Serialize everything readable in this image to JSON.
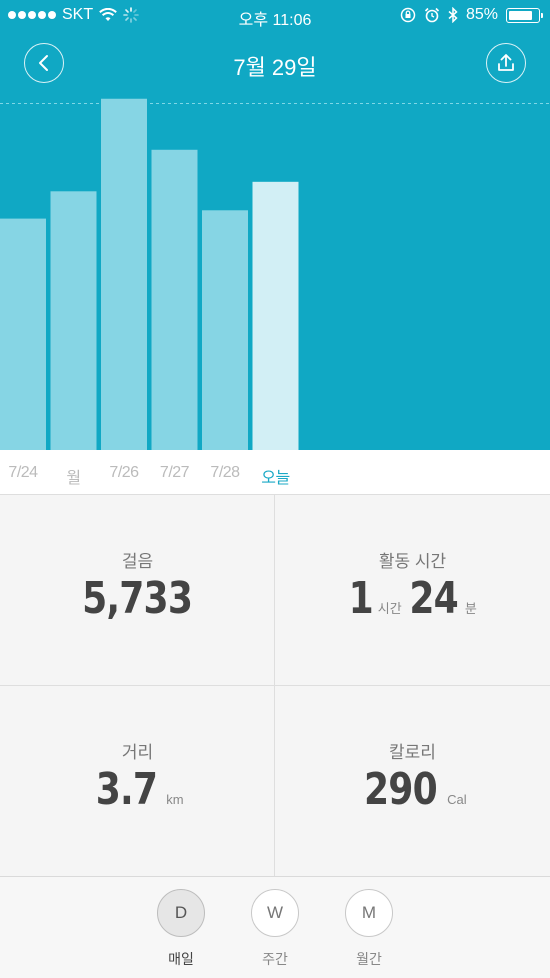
{
  "status_bar": {
    "carrier": "SKT",
    "time": "오후 11:06",
    "battery": "85%",
    "battery_level": 0.85
  },
  "header": {
    "title": "7월 29일",
    "back_icon": "chevron-left-icon",
    "share_icon": "upload-icon"
  },
  "chart_data": {
    "type": "bar",
    "categories": [
      "7/24",
      "월",
      "7/26",
      "7/27",
      "7/28",
      "오늘"
    ],
    "values": [
      195,
      218,
      296,
      253,
      202,
      226
    ],
    "highlight_index": 5,
    "goal_line": 292,
    "ylim": [
      0,
      300
    ],
    "colors": {
      "background": "#10a8c4",
      "bar": "#86d5e4",
      "bar_highlight": "#d2eff5",
      "goal_line": "#7fd6e6"
    }
  },
  "stats": {
    "steps": {
      "label": "걸음",
      "value": "5,733"
    },
    "active_time": {
      "label": "활동 시간",
      "hours": "1",
      "hours_unit": "시간",
      "minutes": "24",
      "minutes_unit": "분"
    },
    "distance": {
      "label": "거리",
      "value": "3.7",
      "unit": "km"
    },
    "calories": {
      "label": "칼로리",
      "value": "290",
      "unit": "Cal"
    }
  },
  "tabs": [
    {
      "letter": "D",
      "label": "매일",
      "selected": true
    },
    {
      "letter": "W",
      "label": "주간",
      "selected": false
    },
    {
      "letter": "M",
      "label": "월간",
      "selected": false
    }
  ]
}
